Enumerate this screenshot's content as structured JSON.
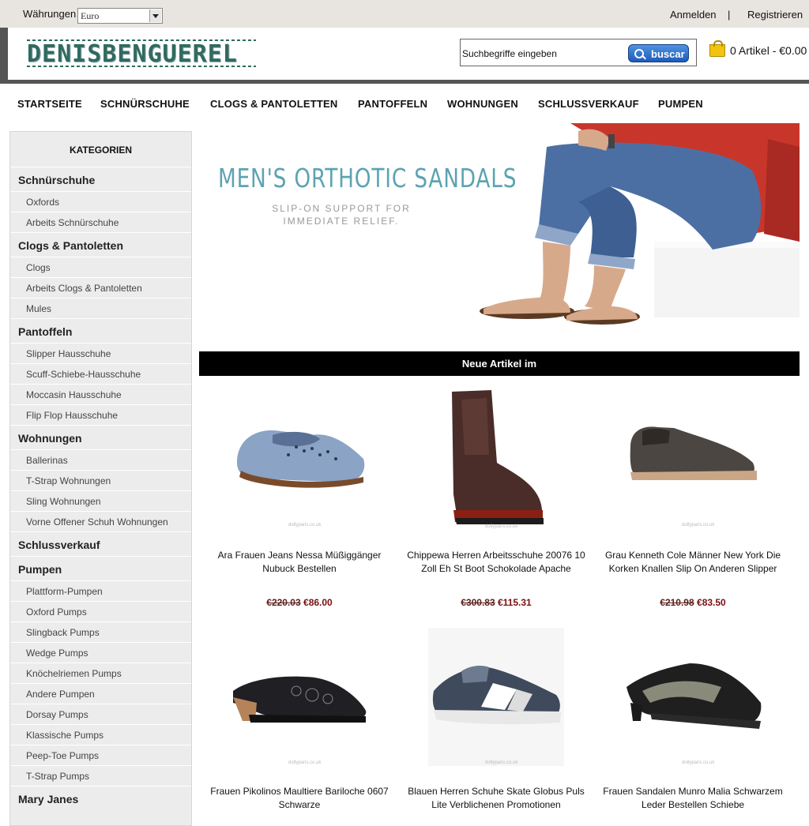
{
  "topbar": {
    "currency_label": "Währungen",
    "currency_value": "Euro",
    "login": "Anmelden",
    "separator": "|",
    "register": "Registrieren"
  },
  "header": {
    "logo_text": "DENISBENGUEREL",
    "search_placeholder": "Suchbegriffe eingeben",
    "search_button": "buscar",
    "cart_text": "0 Artikel - €0.00"
  },
  "nav": [
    "STARTSEITE",
    "SCHNÜRSCHUHE",
    "CLOGS & PANTOLETTEN",
    "PANTOFFELN",
    "WOHNUNGEN",
    "SCHLUSSVERKAUF",
    "PUMPEN"
  ],
  "sidebar": {
    "heading": "KATEGORIEN",
    "items": [
      {
        "label": "Schnürschuhe",
        "type": "cat"
      },
      {
        "label": "Oxfords",
        "type": "sub"
      },
      {
        "label": "Arbeits Schnürschuhe",
        "type": "sub"
      },
      {
        "label": "Clogs & Pantoletten",
        "type": "cat"
      },
      {
        "label": "Clogs",
        "type": "sub"
      },
      {
        "label": "Arbeits Clogs & Pantoletten",
        "type": "sub"
      },
      {
        "label": "Mules",
        "type": "sub"
      },
      {
        "label": "Pantoffeln",
        "type": "cat"
      },
      {
        "label": "Slipper Hausschuhe",
        "type": "sub"
      },
      {
        "label": "Scuff-Schiebe-Hausschuhe",
        "type": "sub"
      },
      {
        "label": "Moccasin Hausschuhe",
        "type": "sub"
      },
      {
        "label": "Flip Flop Hausschuhe",
        "type": "sub"
      },
      {
        "label": "Wohnungen",
        "type": "cat"
      },
      {
        "label": "Ballerinas",
        "type": "sub"
      },
      {
        "label": "T-Strap Wohnungen",
        "type": "sub"
      },
      {
        "label": "Sling Wohnungen",
        "type": "sub"
      },
      {
        "label": "Vorne Offener Schuh Wohnungen",
        "type": "sub"
      },
      {
        "label": "Schlussverkauf",
        "type": "cat"
      },
      {
        "label": "Pumpen",
        "type": "cat"
      },
      {
        "label": "Plattform-Pumpen",
        "type": "sub"
      },
      {
        "label": "Oxford Pumps",
        "type": "sub"
      },
      {
        "label": "Slingback Pumps",
        "type": "sub"
      },
      {
        "label": "Wedge Pumps",
        "type": "sub"
      },
      {
        "label": "Knöchelriemen Pumps",
        "type": "sub"
      },
      {
        "label": "Andere Pumpen",
        "type": "sub"
      },
      {
        "label": "Dorsay Pumps",
        "type": "sub"
      },
      {
        "label": "Klassische Pumps",
        "type": "sub"
      },
      {
        "label": "Peep-Toe Pumps",
        "type": "sub"
      },
      {
        "label": "T-Strap Pumps",
        "type": "sub"
      },
      {
        "label": "Mary Janes",
        "type": "cat"
      }
    ]
  },
  "banner": {
    "title": "MEN'S ORTHOTIC SANDALS",
    "subtitle_line1": "SLIP-ON SUPPORT FOR",
    "subtitle_line2": "IMMEDIATE RELIEF."
  },
  "section_title": "Neue Artikel im",
  "products": [
    {
      "name_line1": "Ara Frauen Jeans Nessa Müßiggänger",
      "name_line2": "Nubuck Bestellen",
      "old_price": "€220.03",
      "new_price": "€86.00",
      "image": "blue-loafer"
    },
    {
      "name_line1": "Chippewa Herren Arbeitsschuhe 20076 10",
      "name_line2": "Zoll Eh St Boot Schokolade Apache",
      "old_price": "€300.83",
      "new_price": "€115.31",
      "image": "brown-boot"
    },
    {
      "name_line1": "Grau Kenneth Cole Männer New York Die",
      "name_line2": "Korken Knallen Slip On Anderen Slipper",
      "old_price": "€210.98",
      "new_price": "€83.50",
      "image": "grey-slipon"
    },
    {
      "name_line1": "Frauen Pikolinos Maultiere Bariloche 0607",
      "name_line2": "Schwarze",
      "old_price": "",
      "new_price": "",
      "image": "black-mule"
    },
    {
      "name_line1": "Blauen Herren Schuhe Skate Globus Puls",
      "name_line2": "Lite Verblichenen Promotionen",
      "old_price": "",
      "new_price": "",
      "image": "blue-sneaker"
    },
    {
      "name_line1": "Frauen Sandalen Munro Malia Schwarzem",
      "name_line2": "Leder Bestellen Schiebe",
      "old_price": "",
      "new_price": "",
      "image": "black-sandal"
    }
  ],
  "product_watermark": "dollyparis.co.uk",
  "colors": {
    "topbar_bg": "#e8e4df",
    "logo": "#2f6b5e",
    "banner_title": "#5da3b2",
    "price_new": "#7a0e10",
    "search_button": "#1e5bb8"
  }
}
